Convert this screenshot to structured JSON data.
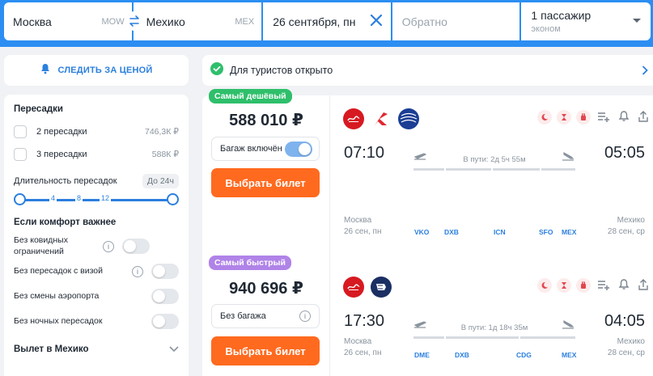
{
  "search": {
    "origin": "Москва",
    "origin_code": "MOW",
    "destination": "Мехико",
    "destination_code": "MEX",
    "date": "26 сентября, пн",
    "return_placeholder": "Обратно",
    "passengers": "1 пассажир",
    "class": "эконом"
  },
  "sidebar": {
    "track_label": "СЛЕДИТЬ ЗА ЦЕНОЙ",
    "transfers_title": "Пересадки",
    "transfers": [
      {
        "label": "2 пересадки",
        "price": "746,3К ₽"
      },
      {
        "label": "3 пересадки",
        "price": "588К ₽"
      }
    ],
    "duration_label": "Длительность пересадок",
    "duration_chip": "До 24ч",
    "slider_ticks": [
      "4",
      "8",
      "12"
    ],
    "comfort_title": "Если комфорт важнее",
    "comfort": [
      {
        "label": "Без ковидных ограничений",
        "info": true
      },
      {
        "label": "Без пересадок с визой",
        "info": true
      },
      {
        "label": "Без смены аэропорта",
        "info": false
      },
      {
        "label": "Без ночных пересадок",
        "info": false
      }
    ],
    "departure_title": "Вылет в Мехико"
  },
  "banner": {
    "text": "Для туристов открыто"
  },
  "tickets": [
    {
      "badge": "Самый дешёвый",
      "price": "588 010 ₽",
      "baggage": "Багаж включён",
      "baggage_included": true,
      "buy_label": "Выбрать билет",
      "airlines": [
        "emirates-logo",
        "aeromexico-logo",
        "united-logo"
      ],
      "dep_time": "07:10",
      "dep_city": "Москва",
      "dep_date": "26 сен, пн",
      "arr_time": "05:05",
      "arr_city": "Мехико",
      "arr_date": "28 сен, ср",
      "duration": "В пути: 2д 5ч 55м",
      "airports": [
        "VKO",
        "DXB",
        "ICN",
        "SFO",
        "MEX"
      ]
    },
    {
      "badge": "Самый быстрый",
      "price": "940 696 ₽",
      "baggage": "Без багажа",
      "baggage_included": false,
      "buy_label": "Выбрать билет",
      "airlines": [
        "emirates-logo",
        "airfrance-logo"
      ],
      "dep_time": "17:30",
      "dep_city": "Москва",
      "dep_date": "26 сен, пн",
      "arr_time": "04:05",
      "arr_city": "Мехико",
      "arr_date": "28 сен, ср",
      "duration": "В пути: 1д 18ч 35м",
      "airports": [
        "DME",
        "DXB",
        "CDG",
        "MEX"
      ]
    }
  ],
  "colors": {
    "brand_blue": "#2C8EF2",
    "accent_orange": "#FF6A1F",
    "cheap_green": "#2FBF6B",
    "fast_purple": "#B083E8"
  }
}
